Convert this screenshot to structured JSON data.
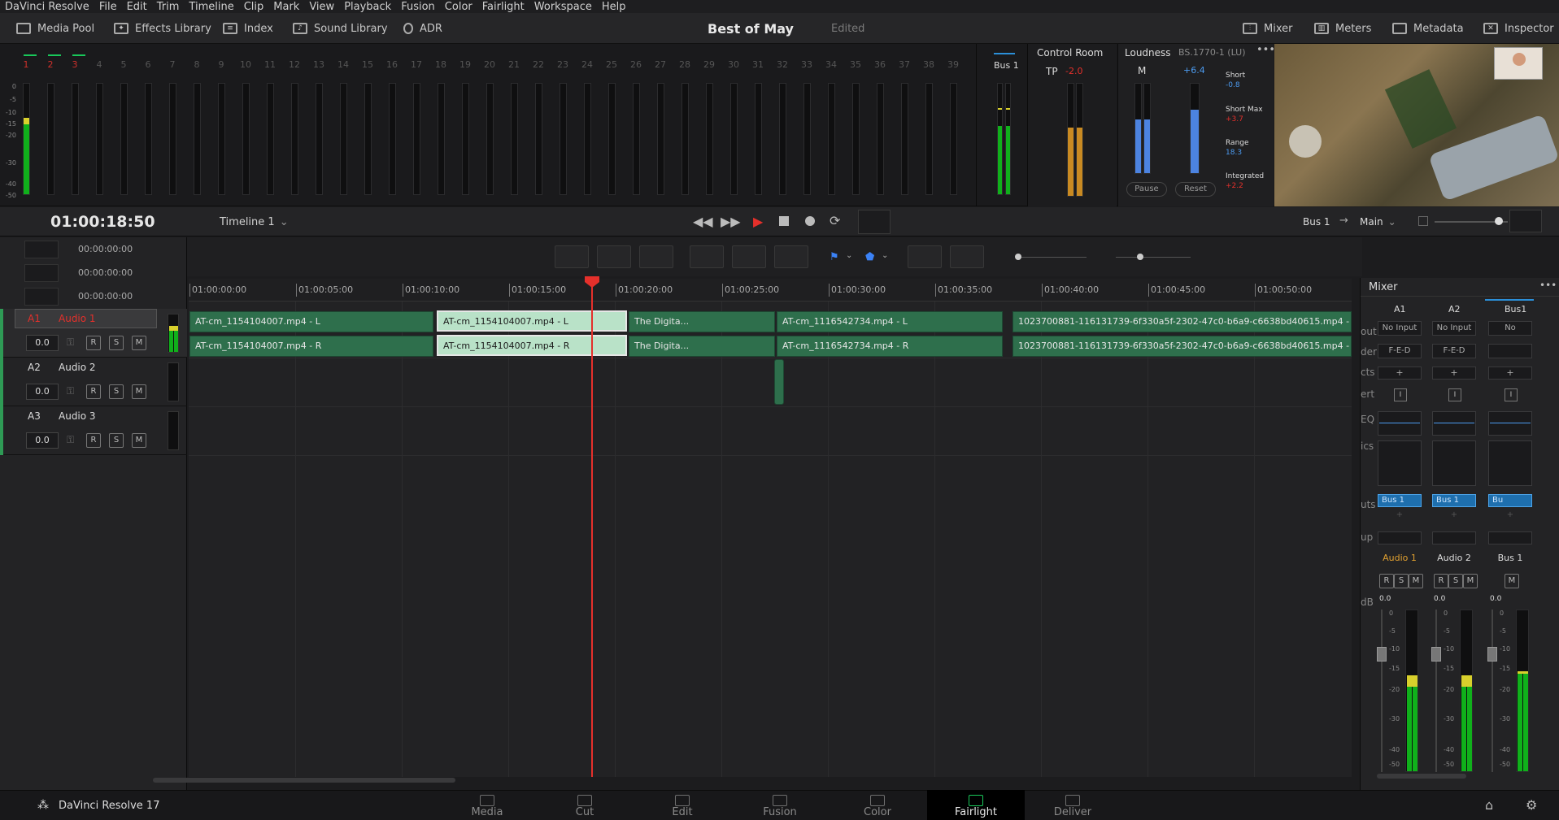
{
  "menu": [
    "DaVinci Resolve",
    "File",
    "Edit",
    "Trim",
    "Timeline",
    "Clip",
    "Mark",
    "View",
    "Playback",
    "Fusion",
    "Color",
    "Fairlight",
    "Workspace",
    "Help"
  ],
  "toolbar": {
    "left": [
      "Media Pool",
      "Effects Library",
      "Index",
      "Sound Library",
      "ADR"
    ],
    "right": [
      "Mixer",
      "Meters",
      "Metadata",
      "Inspector"
    ]
  },
  "project": {
    "title": "Best of May",
    "status": "Edited"
  },
  "meters": {
    "channel_numbers": [
      "1",
      "2",
      "3",
      "4",
      "5",
      "6",
      "7",
      "8",
      "9",
      "10",
      "11",
      "12",
      "13",
      "14",
      "15",
      "16",
      "17",
      "18",
      "19",
      "20",
      "21",
      "22",
      "23",
      "24",
      "25",
      "26",
      "27",
      "28",
      "29",
      "30",
      "31",
      "32",
      "33",
      "34",
      "35",
      "36",
      "37",
      "38",
      "39"
    ],
    "scale": [
      "0",
      "-5",
      "-10",
      "-15",
      "-20",
      "-30",
      "-40",
      "-50"
    ],
    "bus_label": "Bus 1"
  },
  "control_room": {
    "title": "Control Room",
    "tp_label": "TP",
    "tp_value": "-2.0",
    "m_label": "M",
    "m_value": "+6.4",
    "scale": [
      "0",
      "-5",
      "-10",
      "-15",
      "-20",
      "-30",
      "-40",
      "-50"
    ]
  },
  "loudness": {
    "title": "Loudness",
    "standard": "BS.1770-1 (LU)",
    "short_label": "Short",
    "short_value": "-0.8",
    "shortmax_label": "Short Max",
    "shortmax_value": "+3.7",
    "range_label": "Range",
    "range_value": "18.3",
    "integrated_label": "Integrated",
    "integrated_value": "+2.2",
    "pause": "Pause",
    "reset": "Reset",
    "scale": [
      "+9",
      "+3",
      "0",
      "-3",
      "-9",
      "-18"
    ]
  },
  "transport": {
    "timecode": "01:00:18:50",
    "timeline": "Timeline 1",
    "bus": "Bus 1",
    "output": "Main"
  },
  "tracks": [
    {
      "id": "A1",
      "name": "Audio 1",
      "vol": "0.0"
    },
    {
      "id": "A2",
      "name": "Audio 2",
      "vol": "0.0"
    },
    {
      "id": "A3",
      "name": "Audio 3",
      "vol": "0.0"
    }
  ],
  "track_buttons": {
    "r": "R",
    "s": "S",
    "m": "M"
  },
  "timecode_fields": [
    "00:00:00:00",
    "00:00:00:00",
    "00:00:00:00"
  ],
  "ruler": [
    "01:00:00:00",
    "01:00:05:00",
    "01:00:10:00",
    "01:00:15:00",
    "01:00:20:00",
    "01:00:25:00",
    "01:00:30:00",
    "01:00:35:00",
    "01:00:40:00",
    "01:00:45:00",
    "01:00:50:00"
  ],
  "clips": {
    "c1l": "AT-cm_1154104007.mp4 - L",
    "c1r": "AT-cm_1154104007.mp4 - R",
    "c2l": "AT-cm_1154104007.mp4 - L",
    "c2r": "AT-cm_1154104007.mp4 - R",
    "c3": "The Digita...",
    "c4l": "AT-cm_1116542734.mp4 - L",
    "c4r": "AT-cm_1116542734.mp4 - R",
    "c5l": "1023700881-116131739-6f330a5f-2302-47c0-b6a9-c6638bd40615.mp4 - L",
    "c5r": "1023700881-116131739-6f330a5f-2302-47c0-b6a9-c6638bd40615.mp4 - R"
  },
  "mixer": {
    "title": "Mixer",
    "row_labels": [
      "out",
      "der",
      "cts",
      "ert",
      "EQ",
      "ics",
      "uts",
      "up",
      "dB"
    ],
    "columns": [
      {
        "id": "A1",
        "input": "No Input",
        "order": "F-E-D",
        "bus": "Bus 1",
        "name": "Audio 1",
        "vol": "0.0"
      },
      {
        "id": "A2",
        "input": "No Input",
        "order": "F-E-D",
        "bus": "Bus 1",
        "name": "Audio 2",
        "vol": "0.0"
      },
      {
        "id": "Bus1",
        "input": "No",
        "order": "",
        "bus": "Bu",
        "name": "Bus 1",
        "vol": "0.0"
      }
    ],
    "plus": "+",
    "insert": "I",
    "fader_scale": [
      "0",
      "-5",
      "-10",
      "-15",
      "-20",
      "-30",
      "-40",
      "-50"
    ],
    "btn_r": "R",
    "btn_s": "S",
    "btn_m": "M"
  },
  "pages": [
    "Media",
    "Cut",
    "Edit",
    "Fusion",
    "Color",
    "Fairlight",
    "Deliver"
  ],
  "active_page": "Fairlight",
  "brand": "DaVinci Resolve 17",
  "colors": {
    "accent_red": "#e5302b",
    "clip_green": "#2e6f4c",
    "meter_green": "#10b01b",
    "bus_blue": "#2b8fd8"
  }
}
